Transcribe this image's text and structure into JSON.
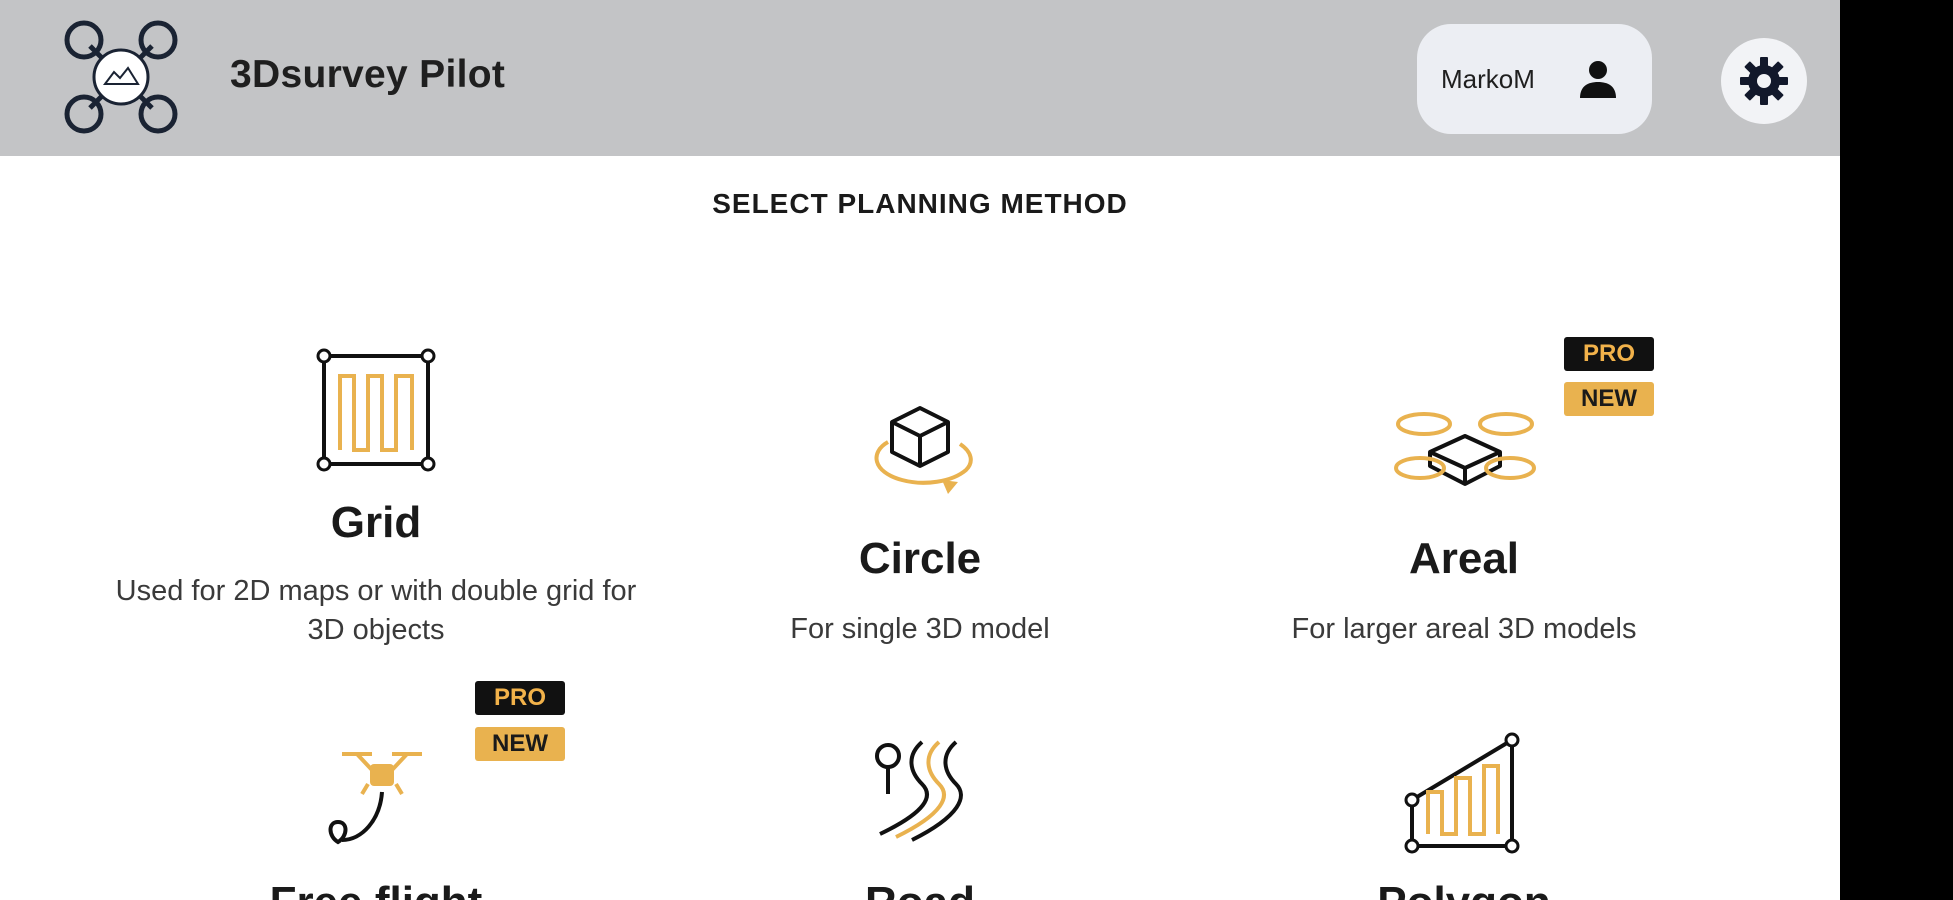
{
  "header": {
    "app_title": "3Dsurvey Pilot",
    "username": "MarkoM",
    "user_icon": "person-icon",
    "settings_icon": "gear-icon",
    "logo_icon": "drone-logo-icon"
  },
  "main": {
    "section_title": "SELECT PLANNING METHOD",
    "methods": [
      {
        "title": "Grid",
        "description": "Used for 2D maps or with double grid for 3D objects",
        "icon": "grid-pattern-icon",
        "badges": []
      },
      {
        "title": "Circle",
        "description": "For single 3D model",
        "icon": "cube-orbit-icon",
        "badges": []
      },
      {
        "title": "Areal",
        "description": "For larger areal 3D models",
        "icon": "areal-orbit-icon",
        "badges": [
          "PRO",
          "NEW"
        ]
      },
      {
        "title": "Free flight",
        "description": "",
        "icon": "drone-path-icon",
        "badges": [
          "PRO",
          "NEW"
        ]
      },
      {
        "title": "Road",
        "description": "",
        "icon": "road-icon",
        "badges": []
      },
      {
        "title": "Polygon",
        "description": "",
        "icon": "polygon-grid-icon",
        "badges": []
      }
    ]
  },
  "colors": {
    "accent": "#e9b24f",
    "header_bg": "#c3c4c6",
    "pro_badge_bg": "#111111"
  }
}
